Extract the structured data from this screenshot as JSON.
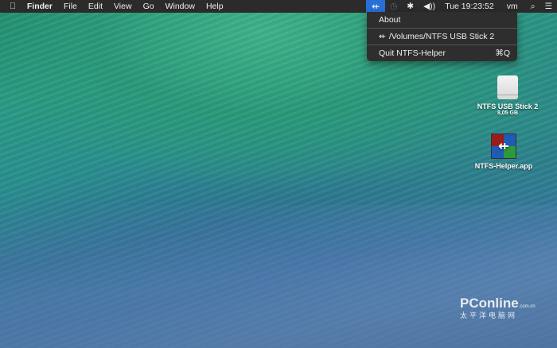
{
  "menubar": {
    "apple": "",
    "app": "Finder",
    "items": [
      "File",
      "Edit",
      "View",
      "Go",
      "Window",
      "Help"
    ],
    "status": {
      "usb": "⭠",
      "time_machine": "◷",
      "bluetooth": "✱",
      "volume": "🔊",
      "clock": "Tue 19:23:52",
      "user": "vm",
      "search": "⌕",
      "list": "☰"
    }
  },
  "dropdown": {
    "about": "About",
    "volume": "/Volumes/NTFS USB Stick 2",
    "quit": "Quit NTFS-Helper",
    "quit_shortcut": "⌘Q"
  },
  "desktop": {
    "drive_name": "NTFS USB Stick 2",
    "drive_size": "8,05 GB",
    "app_name": "NTFS-Helper.app"
  },
  "watermark": {
    "brand": "PConline",
    "domain": ".com.cn",
    "cn": "太平洋电脑网"
  }
}
